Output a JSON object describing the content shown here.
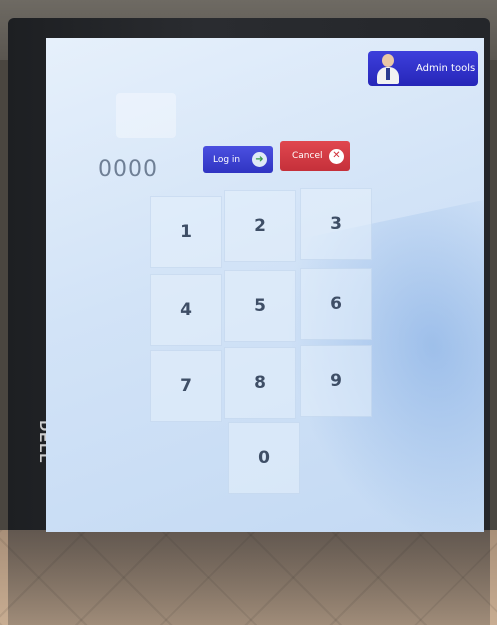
{
  "admin": {
    "label": "Admin tools"
  },
  "pin": {
    "value": "0000"
  },
  "actions": {
    "login_label": "Log in",
    "cancel_label": "Cancel"
  },
  "keypad": {
    "keys": [
      "1",
      "2",
      "3",
      "4",
      "5",
      "6",
      "7",
      "8",
      "9",
      "0"
    ]
  },
  "device": {
    "brand": "DELL"
  },
  "colors": {
    "login_button": "#3a3fd4",
    "cancel_button": "#d63a44",
    "admin_button": "#2f31c8",
    "screen_bg": "#d6e6f8"
  }
}
